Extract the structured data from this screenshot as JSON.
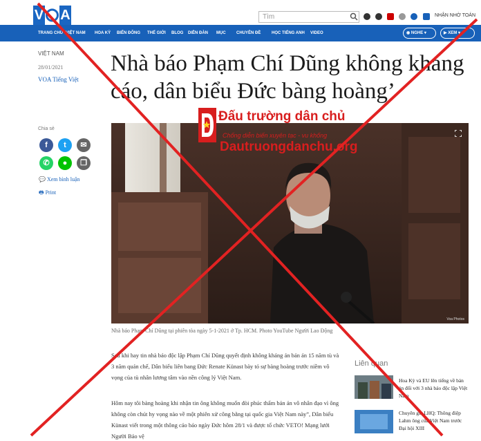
{
  "logo": {
    "text_a": "V",
    "text_b": "A"
  },
  "search": {
    "placeholder": "Tìm"
  },
  "app_label": "NHẬN NHỜ TOÁN",
  "nav": {
    "items": [
      "TRANG CHỦ",
      "VIỆT NAM",
      "HOA KỲ",
      "BIỂN ĐÔNG",
      "THẾ GIỚI",
      "BLOG",
      "DIỄN ĐÀN",
      "MỤC",
      "CHUYÊN ĐỀ",
      "HỌC TIẾNG ANH",
      "VIDEO"
    ],
    "radio_label": "NGHE",
    "video_label": "XEM"
  },
  "meta": {
    "section": "VIỆT NAM",
    "date": "28/01/2021",
    "source": "VOA Tiếng Việt"
  },
  "headline": "Nhà báo Phạm Chí Dũng không kháng cáo, dân biểu Đức  bàng hoàng’",
  "share": {
    "label": "Chia sẻ",
    "comments": "Xem bình luận",
    "print": "Print"
  },
  "photo": {
    "credit": "Voa Photos"
  },
  "caption": "Nhà báo Phạm Chí Dũng tại phiên tòa ngày 5-1-2021 ở Tp. HCM. Photo YouTube Người Lao Động",
  "paragraphs": [
    "Sau khi hay tin nhà báo độc lập Phạm Chí Dũng quyết định không kháng án bản án 15 năm tù và 3 năm quản chế, Dân biểu liên bang Đức Renate Künast bày tỏ sự bàng hoàng trước niềm vô vọng của tù nhân lương tâm vào nền công lý Việt Nam.",
    "Hôm nay tôi bàng hoàng khi nhận tin ông không muốn đòi phúc thẩm bản án vô nhân đạo vì ông không còn chút hy vọng nào về một phiên xử công bằng tại quốc gia Việt Nam này”, Dân biểu Künast viết trong một thông cáo báo ngày Đức hôm 28/1 và được tổ chức VETO! Mạng lưới Người Bảo vệ"
  ],
  "related": {
    "title": "Liên quan",
    "items": [
      "Hoa Kỳ và EU lên tiếng về bản án đối với 3 nhà báo độc lập Việt Nam",
      "Chuyên gia LHQ: Thông điệp Lahm ông của Việt Nam trước Đại hội XIII"
    ]
  },
  "watermark": {
    "title": "Đấu trường dân chủ",
    "subtitle": "Chống diễn biến xuyên tạc - vu khống",
    "url": "Dautruongdanchu.org"
  }
}
